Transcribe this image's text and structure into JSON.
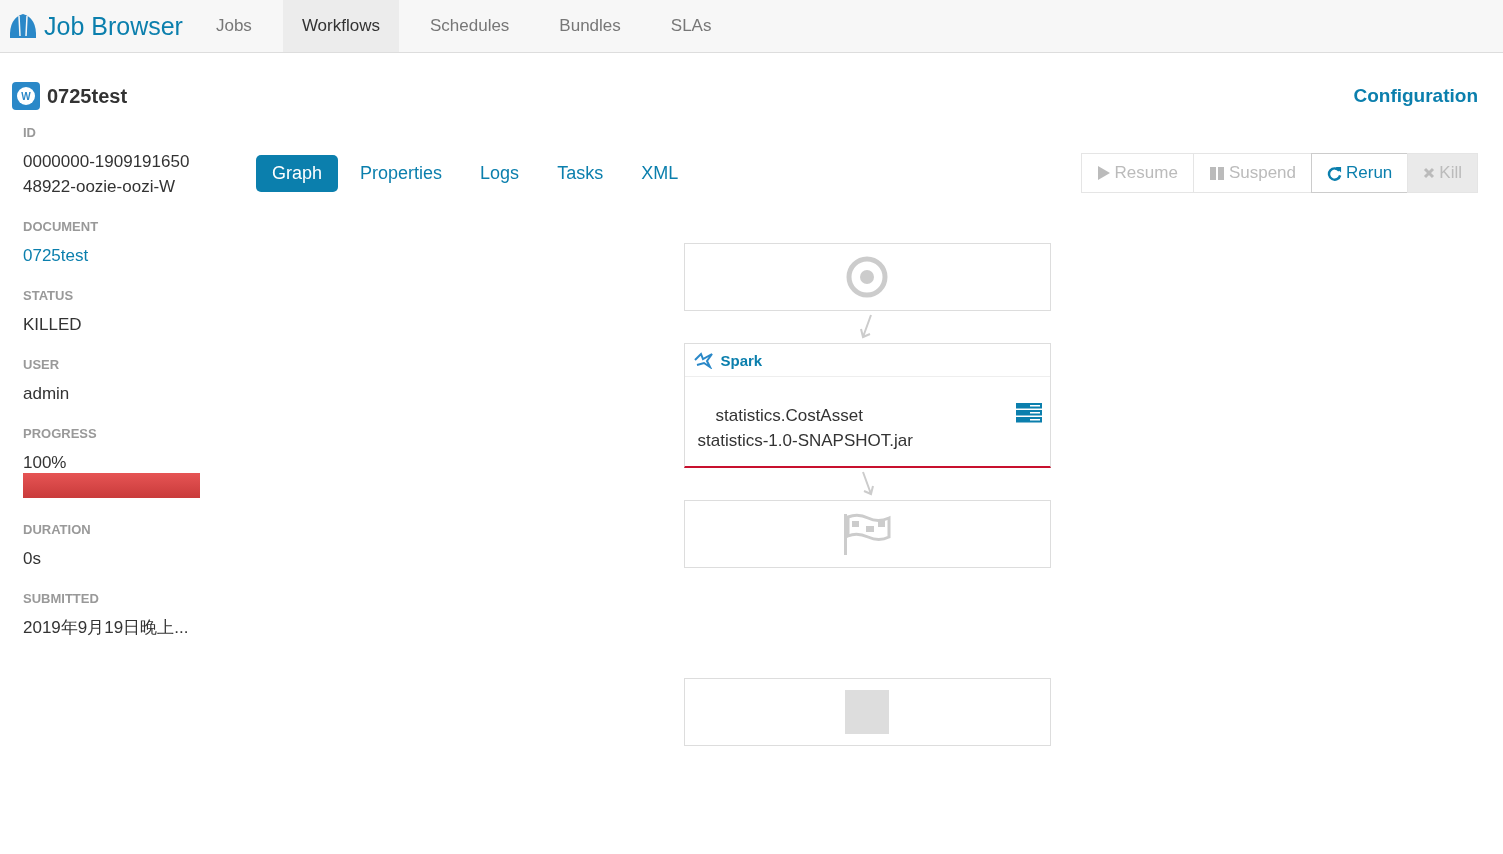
{
  "app": {
    "title": "Job Browser"
  },
  "nav": [
    {
      "label": "Jobs",
      "selected": false
    },
    {
      "label": "Workflows",
      "selected": true
    },
    {
      "label": "Schedules",
      "selected": false
    },
    {
      "label": "Bundles",
      "selected": false
    },
    {
      "label": "SLAs",
      "selected": false
    }
  ],
  "job": {
    "badge": "W",
    "name": "0725test",
    "configuration_link": "Configuration"
  },
  "details": [
    {
      "label": "ID",
      "value": "0000000-190919165048922-oozie-oozi-W",
      "kind": "text"
    },
    {
      "label": "DOCUMENT",
      "value": "0725test",
      "kind": "link"
    },
    {
      "label": "STATUS",
      "value": "KILLED",
      "kind": "text"
    },
    {
      "label": "USER",
      "value": "admin",
      "kind": "text"
    },
    {
      "label": "PROGRESS",
      "value": "100%",
      "kind": "progress",
      "level": 1
    },
    {
      "label": "DURATION",
      "value": "0s",
      "kind": "text"
    },
    {
      "label": "SUBMITTED",
      "value": "2019年9月19日晚上...",
      "kind": "text"
    }
  ],
  "tabs": [
    {
      "label": "Graph",
      "selected": true
    },
    {
      "label": "Properties",
      "selected": false
    },
    {
      "label": "Logs",
      "selected": false
    },
    {
      "label": "Tasks",
      "selected": false
    },
    {
      "label": "XML",
      "selected": false
    }
  ],
  "actions": [
    {
      "label": "Resume",
      "kind": "resume",
      "disabled": true
    },
    {
      "label": "Suspend",
      "kind": "suspend",
      "disabled": true
    },
    {
      "label": "Rerun",
      "kind": "rerun",
      "disabled": false
    },
    {
      "label": "Kill",
      "kind": "kill",
      "disabled": true
    }
  ],
  "graph": {
    "nodes": [
      {
        "kind": "start"
      },
      {
        "kind": "action",
        "title": "Spark",
        "lines": [
          "statistics.CostAsset",
          "statistics-1.0-SNAPSHOT.jar"
        ],
        "failed": true
      },
      {
        "kind": "end"
      },
      {
        "kind": "kill"
      }
    ]
  }
}
